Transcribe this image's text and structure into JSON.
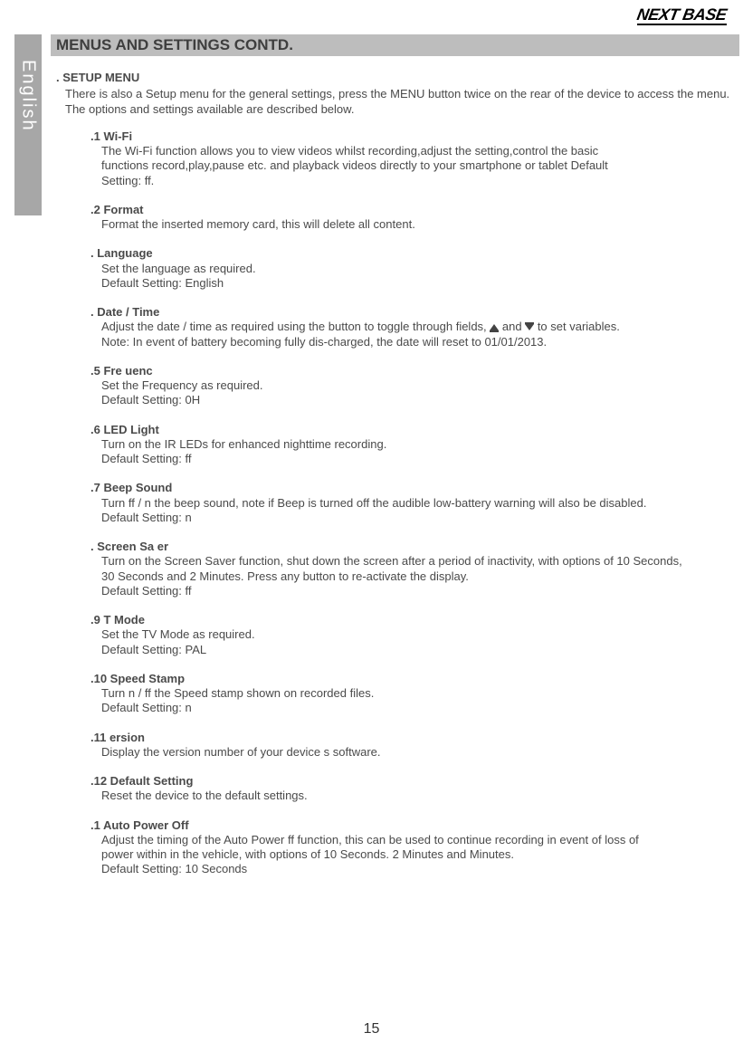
{
  "brand": "NEXT BASE",
  "language_tab": "English",
  "header": "MENUS AND SETTINGS  CONTD.",
  "intro": {
    "title": ". SETUP MENU",
    "body": "There is also a Setup menu for the general settings, press the MENU button twice on the rear of the device to access the menu. The options and settings available are described below."
  },
  "items": [
    {
      "title": ".1 Wi-Fi",
      "lines": [
        "The Wi-Fi function allows you to view videos whilst recording,adjust the setting,control the basic",
        "functions record,play,pause etc.  and playback videos directly to your smartphone or tablet Default",
        "Setting:   ff."
      ]
    },
    {
      "title": ".2 Format",
      "lines": [
        "Format the inserted memory card, this will delete all content."
      ]
    },
    {
      "title": ".   Language",
      "lines": [
        "Set the language as required.",
        "Default Setting: English"
      ]
    },
    {
      "title": ".   Date / Time",
      "lines_special": "datetime"
    },
    {
      "title": ".5 Fre  uenc",
      "lines": [
        "Set the Frequency as required.",
        "Default Setting:   0H"
      ]
    },
    {
      "title": ".6 LED Light",
      "lines": [
        "Turn on the IR LEDs for enhanced nighttime recording.",
        "Default Setting:    ff"
      ]
    },
    {
      "title": ".7 Beep Sound",
      "lines": [
        "Turn    ff /    n the beep sound, note if Beep is turned off the audible low-battery warning will also be disabled.",
        "Default Setting:    n"
      ]
    },
    {
      "title": ".   Screen Sa  er",
      "lines": [
        "Turn on the Screen Saver function, shut down the screen after a period of inactivity, with options of 10 Seconds,",
        "30 Seconds and 2 Minutes. Press any button to re-activate the display.",
        "Default Setting:    ff"
      ]
    },
    {
      "title": ".9 T   Mode",
      "lines": [
        " Set the TV Mode as required.",
        " Default Setting: PAL"
      ]
    },
    {
      "title": ".10 Speed Stamp",
      "lines": [
        "Turn    n /    ff the Speed stamp shown on recorded files.",
        "Default Setting:    n"
      ]
    },
    {
      "title": ".11   ersion",
      "lines": [
        "Display the version number of your device s software."
      ]
    },
    {
      "title": ".12 Default Setting",
      "lines": [
        "Reset the device to the default settings."
      ]
    },
    {
      "title": ".1   Auto Power Off",
      "lines": [
        "Adjust the timing of the Auto Power    ff function, this can be used to continue recording in event of loss of",
        "power within in the vehicle, with options of 10 Seconds. 2 Minutes and    Minutes.",
        "Default Setting: 10 Seconds"
      ]
    }
  ],
  "datetime_lines": {
    "pre": "Adjust the date / time as required using the        button to toggle through fields, ",
    "mid": " and ",
    "post": " to set variables.",
    "note": "Note: In event of battery becoming fully dis-charged, the date will reset to 01/01/2013."
  },
  "page_number": "15"
}
